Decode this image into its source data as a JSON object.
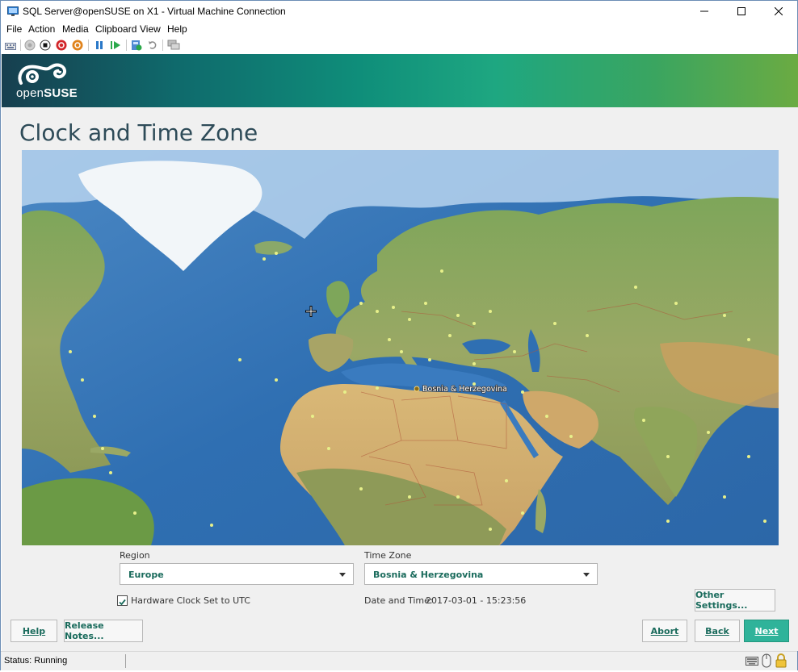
{
  "window": {
    "title": "SQL Server@openSUSE on X1 - Virtual Machine Connection",
    "icon": "vm-connection-icon"
  },
  "menu": [
    "File",
    "Action",
    "Media",
    "Clipboard",
    "View",
    "Help"
  ],
  "toolbar": {
    "icons": [
      "ctrl-alt-del-icon",
      "start-icon",
      "turn-off-icon",
      "shutdown-icon",
      "save-state-icon",
      "pause-icon",
      "resume-icon",
      "checkpoint-icon",
      "revert-icon",
      "enhanced-session-icon"
    ]
  },
  "installer": {
    "logo": {
      "prefix": "open",
      "suffix": "SUSE"
    },
    "heading": "Clock and Time Zone",
    "map": {
      "selected_label": "Bosnia & Herzegovina"
    },
    "region": {
      "label": "Region",
      "value": "Europe"
    },
    "timezone": {
      "label": "Time Zone",
      "value": "Bosnia & Herzegovina"
    },
    "hw_clock": {
      "label": "Hardware Clock Set to UTC",
      "checked": true
    },
    "datetime": {
      "label": "Date and Time:",
      "value": "2017-03-01 - 15:23:56"
    },
    "buttons": {
      "other_settings": "Other Settings...",
      "help": "Help",
      "release_notes": "Release Notes...",
      "abort": "Abort",
      "back": "Back",
      "next": "Next"
    },
    "colors": {
      "accent": "#2fb39a",
      "text_green": "#1a6b5c"
    }
  },
  "status": {
    "text": "Status: Running"
  }
}
